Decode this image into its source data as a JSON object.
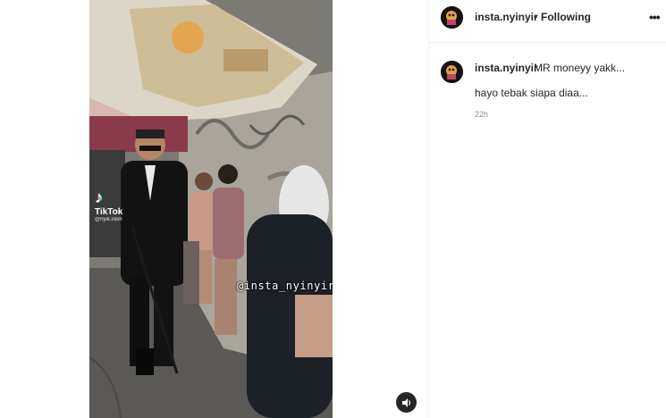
{
  "post": {
    "username": "insta.nyinyir",
    "follow_separator": "•",
    "follow_state": "Following",
    "more_label": "•••",
    "caption_line1": "MR moneyy yakk...",
    "caption_line2": "hayo tebak siapa diaa...",
    "timestamp": "22h"
  },
  "video": {
    "tiktok_brand": "TikTok",
    "tiktok_note": "♪",
    "tiktok_handle": "@nyik.inkih",
    "watermark": "@insta_nyinyir",
    "sound_icon": "speaker-icon"
  },
  "colors": {
    "text": "#262626",
    "secondary_text": "#8e8e8e",
    "divider": "#efefef",
    "sound_button": "#262626"
  }
}
